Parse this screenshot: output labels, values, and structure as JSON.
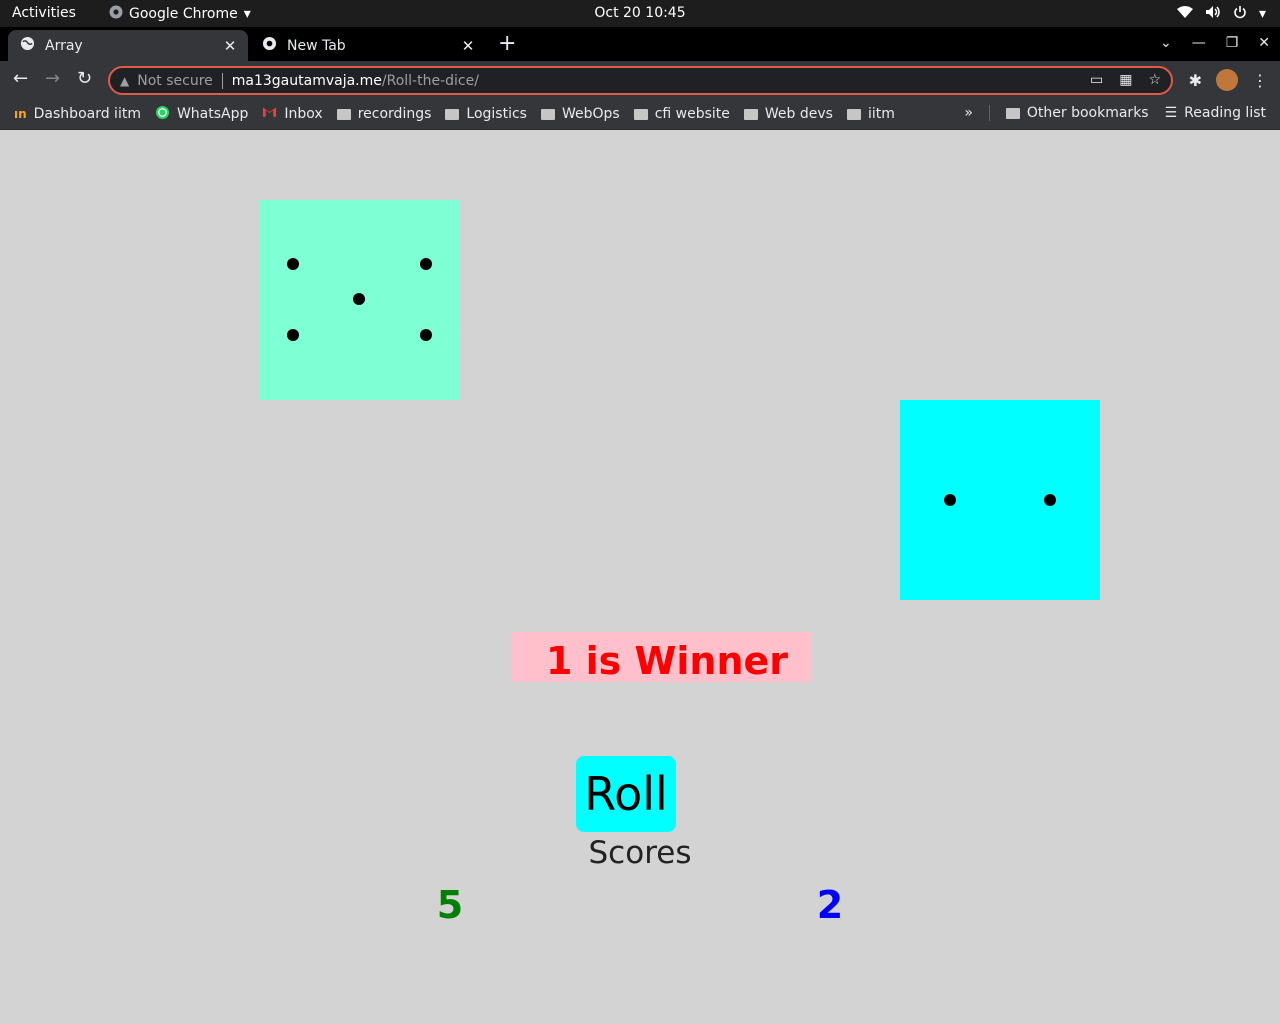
{
  "os_bar": {
    "activities": "Activities",
    "app_name": "Google Chrome",
    "clock": "Oct 20  10:45"
  },
  "tabs": [
    {
      "title": "Array",
      "active": true
    },
    {
      "title": "New Tab",
      "active": false
    }
  ],
  "address_bar": {
    "security_label": "Not secure",
    "host": "ma13gautamvaja.me",
    "path": "/Roll-the-dice/"
  },
  "bookmarks": [
    {
      "label": "Dashboard iitm",
      "icon": "iitm-icon"
    },
    {
      "label": "WhatsApp",
      "icon": "whatsapp-icon"
    },
    {
      "label": "Inbox",
      "icon": "gmail-icon"
    },
    {
      "label": "recordings",
      "icon": "folder-icon"
    },
    {
      "label": "Logistics",
      "icon": "folder-icon"
    },
    {
      "label": "WebOps",
      "icon": "folder-icon"
    },
    {
      "label": "cfi website",
      "icon": "folder-icon"
    },
    {
      "label": "Web devs",
      "icon": "folder-icon"
    },
    {
      "label": "iitm",
      "icon": "folder-icon"
    }
  ],
  "bookmarks_overflow": "»",
  "other_bookmarks": "Other bookmarks",
  "reading_list": "Reading list",
  "game": {
    "die1": {
      "value": 5,
      "color": "#7fffd4"
    },
    "die2": {
      "value": 2,
      "color": "#00ffff"
    },
    "result_text": "1 is Winner",
    "result_color": "#ff0000",
    "roll_label": "Roll",
    "scores_label": "Scores",
    "score_player1": "5",
    "score_player1_color": "#008000",
    "score_player2": "2",
    "score_player2_color": "#0000ff"
  }
}
